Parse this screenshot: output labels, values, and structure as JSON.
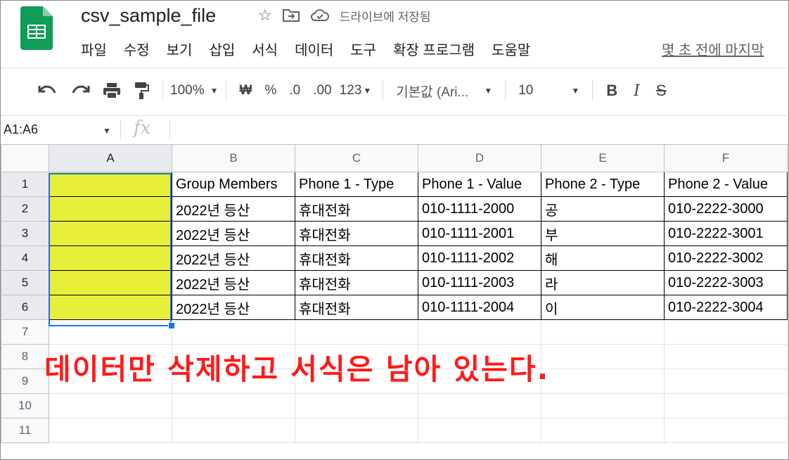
{
  "app": {
    "doc_title": "csv_sample_file",
    "saved_status": "드라이브에 저장됨",
    "last_edit": "몇 초 전에 마지막",
    "brand_color": "#0f9d58"
  },
  "menu": [
    "파일",
    "수정",
    "보기",
    "삽입",
    "서식",
    "데이터",
    "도구",
    "확장 프로그램",
    "도움말"
  ],
  "toolbar": {
    "zoom": "100%",
    "currency": "₩",
    "percent": "%",
    "dec_decrease": ".0",
    "dec_increase": ".00",
    "format": "123",
    "font": "기본값 (Ari...",
    "font_size": "10",
    "bold": "B",
    "italic": "I",
    "strike": "S"
  },
  "formula_bar": {
    "name_box": "A1:A6",
    "fx": "fx",
    "content": ""
  },
  "grid": {
    "columns": [
      "A",
      "B",
      "C",
      "D",
      "E",
      "F"
    ],
    "row_numbers": [
      "1",
      "2",
      "3",
      "4",
      "5",
      "6",
      "7",
      "8",
      "9",
      "10",
      "11"
    ],
    "header_row": [
      "",
      "Group Members",
      "Phone 1 - Type",
      "Phone 1 - Value",
      "Phone 2 - Type",
      "Phone 2 - Value"
    ],
    "rows": [
      [
        "",
        "2022년 등산",
        "휴대전화",
        "010-1111-2000",
        "공",
        "010-2222-3000"
      ],
      [
        "",
        "2022년 등산",
        "휴대전화",
        "010-1111-2001",
        "부",
        "010-2222-3001"
      ],
      [
        "",
        "2022년 등산",
        "휴대전화",
        "010-1111-2002",
        "해",
        "010-2222-3002"
      ],
      [
        "",
        "2022년 등산",
        "휴대전화",
        "010-1111-2003",
        "라",
        "010-2222-3003"
      ],
      [
        "",
        "2022년 등산",
        "휴대전화",
        "010-1111-2004",
        "이",
        "010-2222-3004"
      ]
    ],
    "highlight_color": "#e8ef3a",
    "selection_color": "#1a73e8"
  },
  "annotation": {
    "text": "데이터만 삭제하고 서식은 남아 있는다.",
    "color": "#ff1a1a"
  }
}
